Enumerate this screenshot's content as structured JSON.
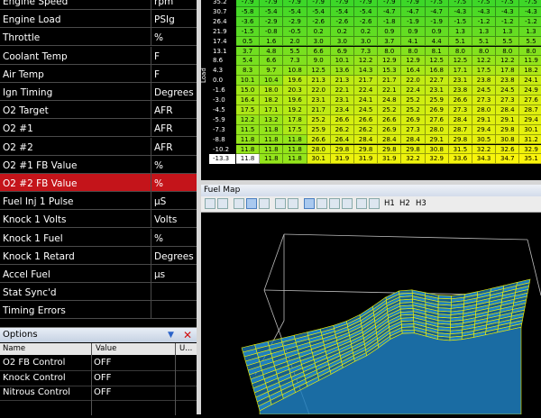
{
  "channels": [
    {
      "name": "Engine Speed",
      "unit": "rpm"
    },
    {
      "name": "Engine Load",
      "unit": "PSIg"
    },
    {
      "name": "Throttle",
      "unit": "%"
    },
    {
      "name": "Coolant Temp",
      "unit": "F"
    },
    {
      "name": "Air Temp",
      "unit": "F"
    },
    {
      "name": "Ign Timing",
      "unit": "Degrees"
    },
    {
      "name": "O2 Target",
      "unit": "AFR"
    },
    {
      "name": "O2 #1",
      "unit": "AFR"
    },
    {
      "name": "O2 #2",
      "unit": "AFR"
    },
    {
      "name": "O2 #1 FB Value",
      "unit": "%"
    },
    {
      "name": "O2 #2 FB Value",
      "unit": "%"
    },
    {
      "name": "Fuel Inj 1 Pulse",
      "unit": "µS"
    },
    {
      "name": "Knock 1 Volts",
      "unit": "Volts"
    },
    {
      "name": "Knock 1 Fuel",
      "unit": "%"
    },
    {
      "name": "Knock 1 Retard",
      "unit": "Degrees"
    },
    {
      "name": "Accel Fuel",
      "unit": "µs"
    },
    {
      "name": "Stat Sync'd",
      "unit": ""
    },
    {
      "name": "Timing Errors",
      "unit": ""
    }
  ],
  "selected_channel": 10,
  "options": {
    "title": "Options",
    "headers": {
      "name": "Name",
      "value": "Value",
      "unit": "U..."
    },
    "rows": [
      {
        "name": "O2 FB Control",
        "value": "OFF"
      },
      {
        "name": "Knock Control",
        "value": "OFF"
      },
      {
        "name": "Nitrous Control",
        "value": "OFF"
      }
    ]
  },
  "table": {
    "axis_label": "Load",
    "row_labels": [
      "35.2",
      "30.7",
      "26.4",
      "21.9",
      "17.4",
      "13.1",
      "8.6",
      "4.3",
      "0.0",
      "-1.6",
      "-3.0",
      "-4.5",
      "-5.9",
      "-7.3",
      "-8.8",
      "-10.2",
      "-13.3"
    ],
    "current_row": 16,
    "values": [
      [
        "-7.9",
        "-7.9",
        "-7.9",
        "-7.9",
        "-7.9",
        "-7.9",
        "-7.9",
        "-7.9",
        "-7.5",
        "-7.5",
        "-7.5",
        "-7.5",
        "-7.5"
      ],
      [
        "-5.8",
        "-5.4",
        "-5.4",
        "-5.4",
        "-5.4",
        "-5.4",
        "-4.7",
        "-4.7",
        "-4.7",
        "-4.3",
        "-4.3",
        "-4.3",
        "-4.3"
      ],
      [
        "-3.6",
        "-2.9",
        "-2.9",
        "-2.6",
        "-2.6",
        "-2.6",
        "-1.8",
        "-1.9",
        "-1.9",
        "-1.5",
        "-1.2",
        "-1.2",
        "-1.2"
      ],
      [
        "-1.5",
        "-0.8",
        "-0.5",
        "0.2",
        "0.2",
        "0.2",
        "0.9",
        "0.9",
        "0.9",
        "1.3",
        "1.3",
        "1.3",
        "1.3"
      ],
      [
        "0.5",
        "1.6",
        "2.0",
        "3.0",
        "3.0",
        "3.0",
        "3.7",
        "4.1",
        "4.4",
        "5.1",
        "5.1",
        "5.5",
        "5.5"
      ],
      [
        "3.7",
        "4.8",
        "5.5",
        "6.6",
        "6.9",
        "7.3",
        "8.0",
        "8.0",
        "8.1",
        "8.0",
        "8.0",
        "8.0",
        "8.0"
      ],
      [
        "5.4",
        "6.6",
        "7.3",
        "9.0",
        "10.1",
        "12.2",
        "12.9",
        "12.9",
        "12.5",
        "12.5",
        "12.2",
        "12.2",
        "11.9"
      ],
      [
        "8.3",
        "9.7",
        "10.8",
        "12.5",
        "13.6",
        "14.3",
        "15.3",
        "16.4",
        "16.8",
        "17.1",
        "17.5",
        "17.8",
        "18.2"
      ],
      [
        "10.1",
        "10.4",
        "19.6",
        "21.3",
        "21.3",
        "21.7",
        "21.7",
        "22.0",
        "22.7",
        "23.1",
        "23.8",
        "23.8",
        "24.1"
      ],
      [
        "15.0",
        "18.0",
        "20.3",
        "22.0",
        "22.1",
        "22.4",
        "22.1",
        "22.4",
        "23.1",
        "23.8",
        "24.5",
        "24.5",
        "24.9"
      ],
      [
        "16.4",
        "18.2",
        "19.6",
        "23.1",
        "23.1",
        "24.1",
        "24.8",
        "25.2",
        "25.9",
        "26.6",
        "27.3",
        "27.3",
        "27.6"
      ],
      [
        "17.5",
        "17.1",
        "19.2",
        "21.7",
        "23.4",
        "24.5",
        "25.2",
        "25.2",
        "26.9",
        "27.3",
        "28.0",
        "28.4",
        "28.7"
      ],
      [
        "12.2",
        "13.2",
        "17.8",
        "25.2",
        "26.6",
        "26.6",
        "26.6",
        "26.9",
        "27.6",
        "28.4",
        "29.1",
        "29.1",
        "29.4"
      ],
      [
        "11.5",
        "11.8",
        "17.5",
        "25.9",
        "26.2",
        "26.2",
        "26.9",
        "27.3",
        "28.0",
        "28.7",
        "29.4",
        "29.8",
        "30.1"
      ],
      [
        "11.8",
        "11.8",
        "11.8",
        "26.6",
        "26.4",
        "28.4",
        "28.4",
        "28.4",
        "29.1",
        "29.8",
        "30.5",
        "30.8",
        "31.2"
      ],
      [
        "11.8",
        "11.8",
        "11.8",
        "28.0",
        "29.8",
        "29.8",
        "29.8",
        "29.8",
        "30.8",
        "31.5",
        "32.2",
        "32.6",
        "32.9"
      ],
      [
        "11.8",
        "11.8",
        "11.8",
        "30.1",
        "31.9",
        "31.9",
        "31.9",
        "32.2",
        "32.9",
        "33.6",
        "34.3",
        "34.7",
        "35.1"
      ]
    ]
  },
  "fuel_map": {
    "title": "Fuel Map",
    "toolbar_labels": [
      "H1",
      "H2",
      "H3"
    ]
  },
  "colors": {
    "selected_row": "#c4141a",
    "surface_fill": "#1e7fbf",
    "surface_grid": "#f2f200"
  }
}
